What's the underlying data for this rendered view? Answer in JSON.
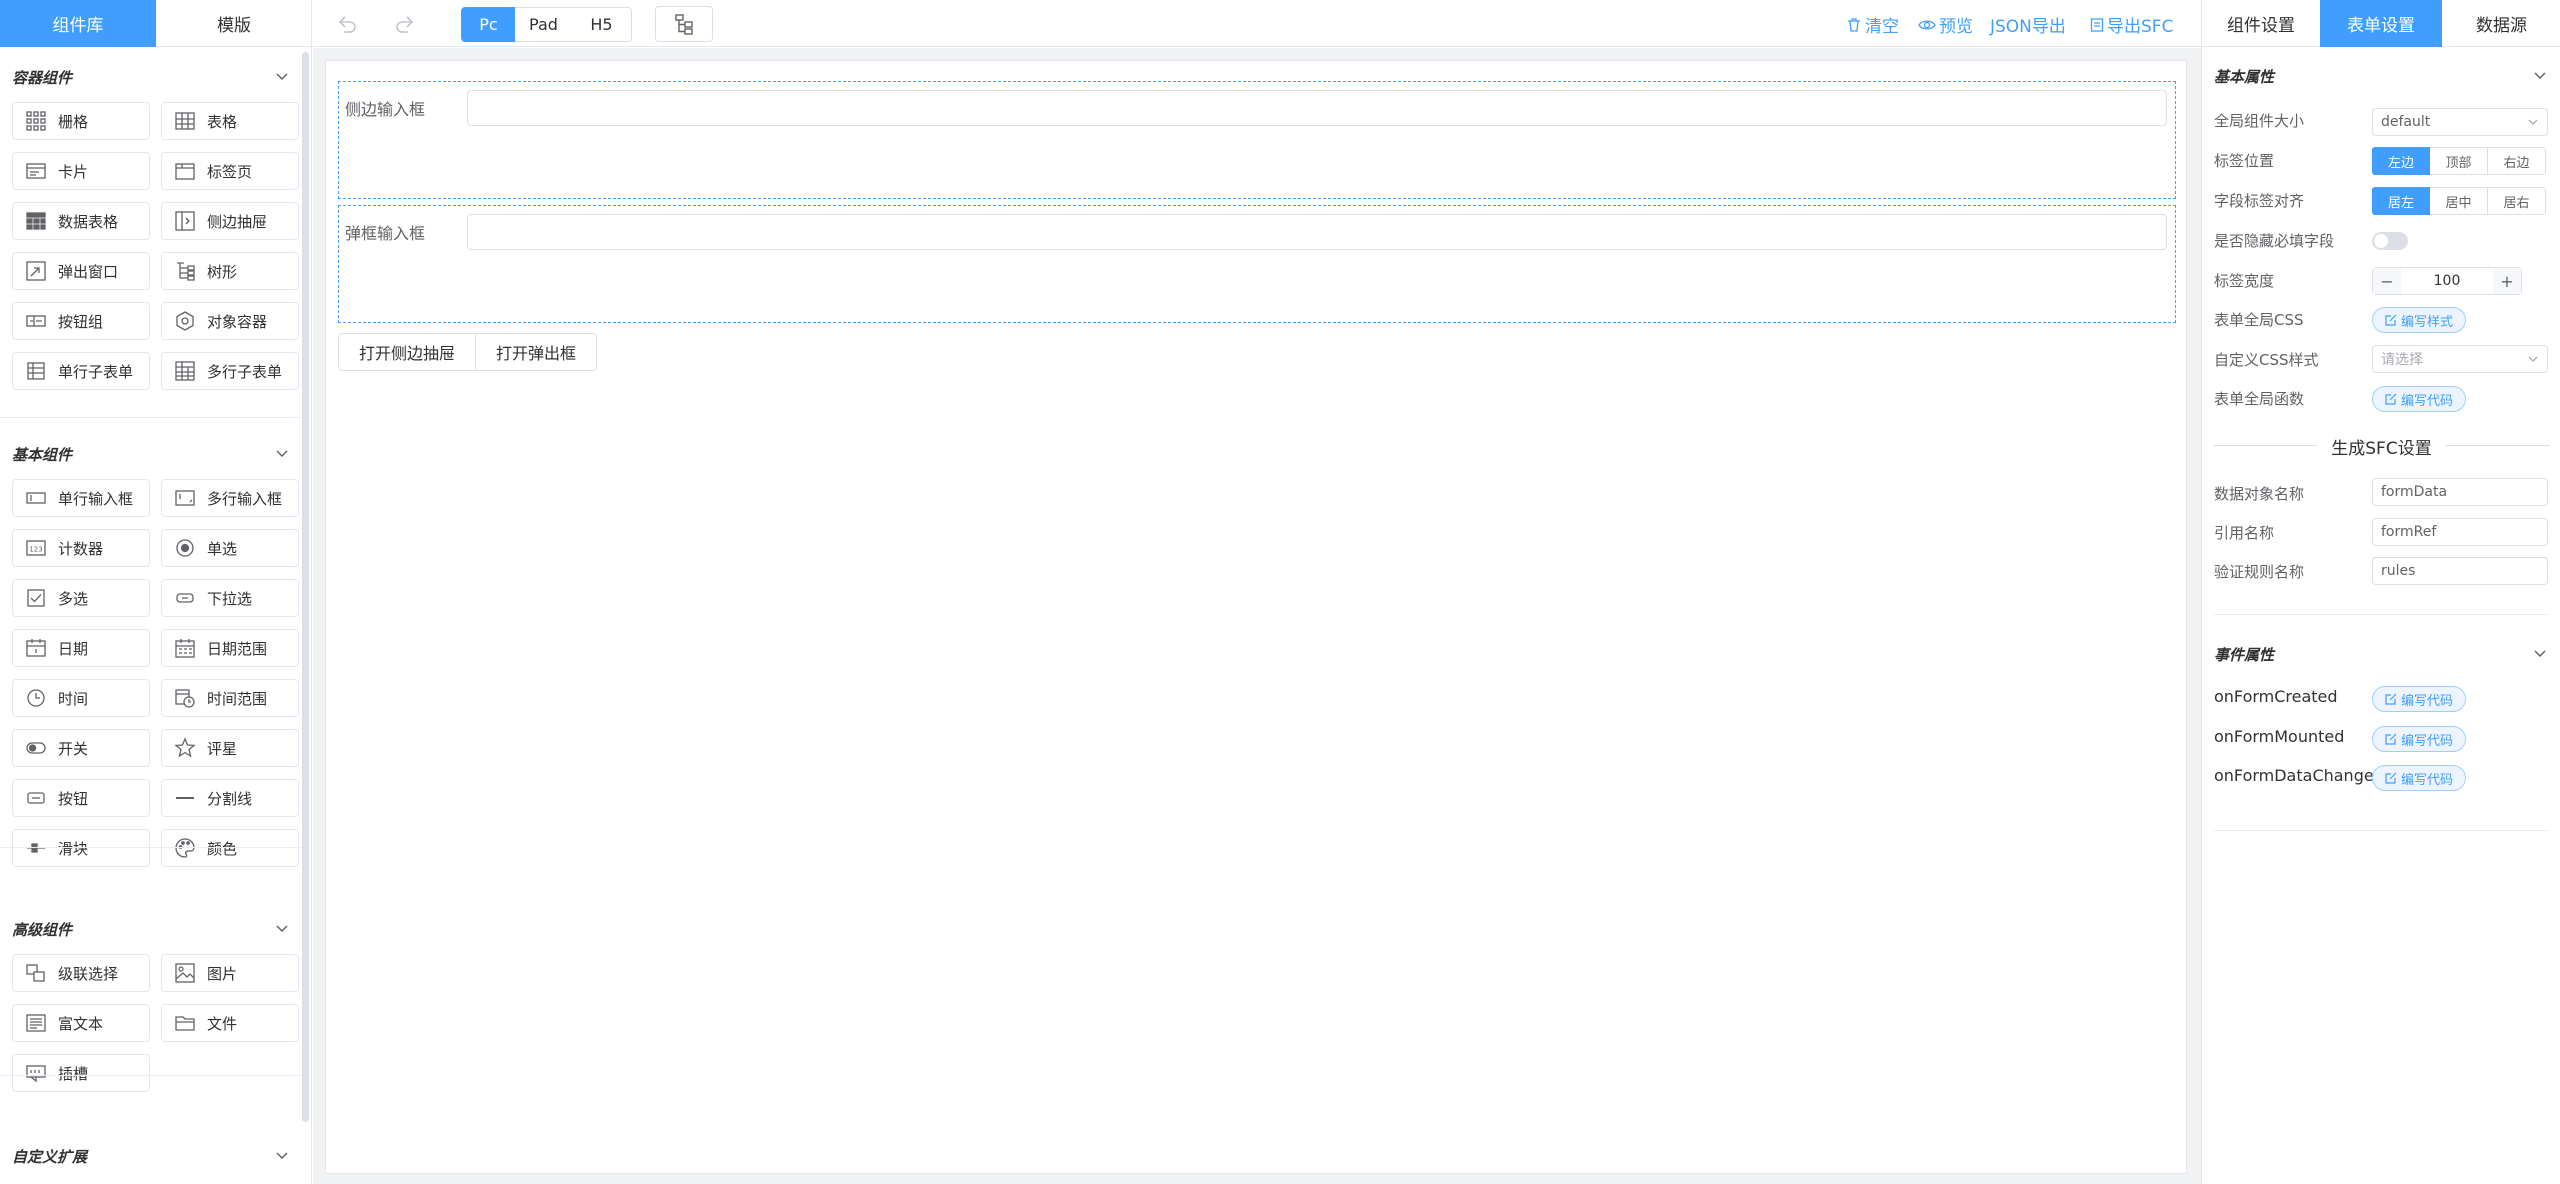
{
  "left": {
    "tabs": [
      "组件库",
      "模版"
    ],
    "groups": [
      {
        "title": "容器组件",
        "items": [
          {
            "label": "栅格",
            "icon": "grid-icon"
          },
          {
            "label": "表格",
            "icon": "table-icon"
          },
          {
            "label": "卡片",
            "icon": "card-icon"
          },
          {
            "label": "标签页",
            "icon": "tab-icon"
          },
          {
            "label": "数据表格",
            "icon": "data-table-icon"
          },
          {
            "label": "侧边抽屉",
            "icon": "drawer-icon"
          },
          {
            "label": "弹出窗口",
            "icon": "dialog-icon"
          },
          {
            "label": "树形",
            "icon": "tree-icon"
          },
          {
            "label": "按钮组",
            "icon": "button-group-icon"
          },
          {
            "label": "对象容器",
            "icon": "object-container-icon"
          },
          {
            "label": "单行子表单",
            "icon": "sub-form-icon"
          },
          {
            "label": "多行子表单",
            "icon": "grid-sub-form-icon"
          }
        ]
      },
      {
        "title": "基本组件",
        "items": [
          {
            "label": "单行输入框",
            "icon": "text-field-icon"
          },
          {
            "label": "多行输入框",
            "icon": "textarea-icon"
          },
          {
            "label": "计数器",
            "icon": "number-icon"
          },
          {
            "label": "单选",
            "icon": "radio-icon"
          },
          {
            "label": "多选",
            "icon": "checkbox-icon"
          },
          {
            "label": "下拉选",
            "icon": "select-icon"
          },
          {
            "label": "日期",
            "icon": "date-icon"
          },
          {
            "label": "日期范围",
            "icon": "date-range-icon"
          },
          {
            "label": "时间",
            "icon": "time-icon"
          },
          {
            "label": "时间范围",
            "icon": "time-range-icon"
          },
          {
            "label": "开关",
            "icon": "switch-icon"
          },
          {
            "label": "评星",
            "icon": "rate-star-icon"
          },
          {
            "label": "按钮",
            "icon": "button-icon"
          },
          {
            "label": "分割线",
            "icon": "divider-icon"
          },
          {
            "label": "滑块",
            "icon": "slider-icon"
          },
          {
            "label": "颜色",
            "icon": "color-palette-icon"
          }
        ]
      },
      {
        "title": "高级组件",
        "items": [
          {
            "label": "级联选择",
            "icon": "cascader-icon"
          },
          {
            "label": "图片",
            "icon": "picture-icon"
          },
          {
            "label": "富文本",
            "icon": "rich-text-icon"
          },
          {
            "label": "文件",
            "icon": "folder-icon"
          },
          {
            "label": "插槽",
            "icon": "slot-icon"
          }
        ]
      },
      {
        "title": "自定义扩展",
        "items": []
      }
    ]
  },
  "toolbar": {
    "devices": [
      "Pc",
      "Pad",
      "H5"
    ],
    "active_device": "Pc",
    "clear": "清空",
    "preview": "预览",
    "export_json": "JSON导出",
    "export_sfc": "导出SFC"
  },
  "canvas": {
    "widgets": [
      {
        "label": "侧边输入框"
      },
      {
        "label": "弹框输入框"
      }
    ],
    "buttons": [
      "打开侧边抽屉",
      "打开弹出框"
    ]
  },
  "right": {
    "tabs": [
      "组件设置",
      "表单设置",
      "数据源"
    ],
    "active_tab": "表单设置",
    "basic_title": "基本属性",
    "size_label": "全局组件大小",
    "size_value": "default",
    "label_pos_label": "标签位置",
    "label_pos_options": [
      "左边",
      "顶部",
      "右边"
    ],
    "label_align_label": "字段标签对齐",
    "label_align_options": [
      "居左",
      "居中",
      "居右"
    ],
    "hide_required_label": "是否隐藏必填字段",
    "hide_required_value": false,
    "label_width_label": "标签宽度",
    "label_width_value": "100",
    "form_css_label": "表单全局CSS",
    "edit_style": "编写样式",
    "custom_css_label": "自定义CSS样式",
    "custom_css_placeholder": "请选择",
    "form_func_label": "表单全局函数",
    "edit_code": "编写代码",
    "sfc_title": "生成SFC设置",
    "data_obj_label": "数据对象名称",
    "data_obj_value": "formData",
    "ref_label": "引用名称",
    "ref_value": "formRef",
    "rules_label": "验证规则名称",
    "rules_value": "rules",
    "events_title": "事件属性",
    "events": [
      "onFormCreated",
      "onFormMounted",
      "onFormDataChange"
    ]
  },
  "colors": {
    "accent": "#409eff",
    "border": "#dcdfe6",
    "canvas_bg": "#f1f2f3"
  }
}
